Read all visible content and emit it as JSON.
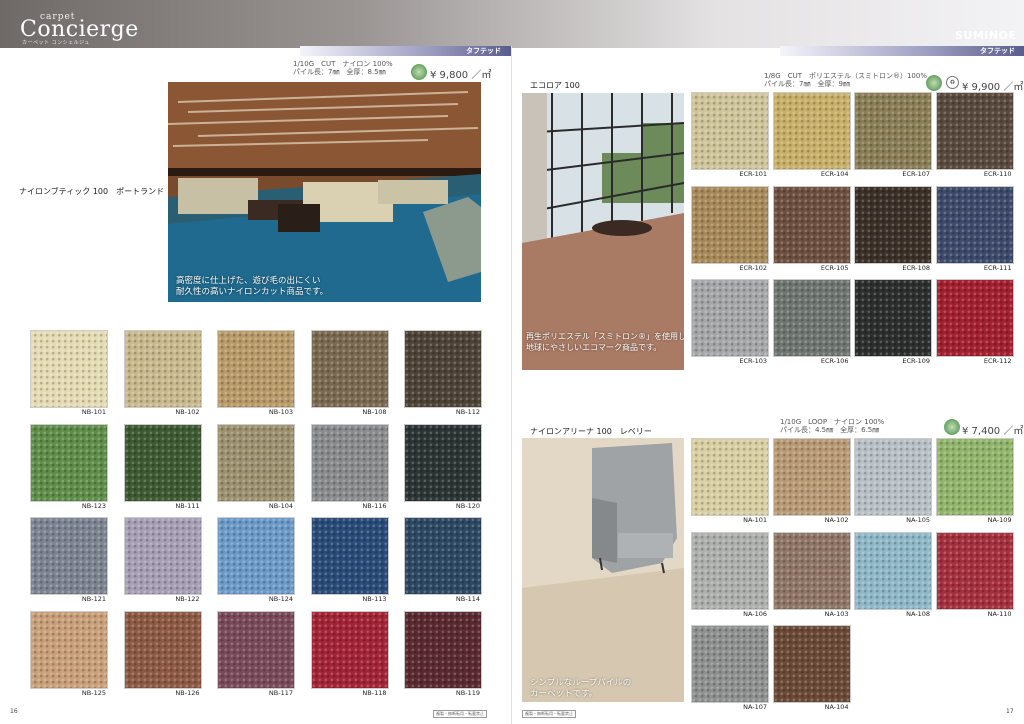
{
  "brand": {
    "small": "carpet",
    "big": "Concierge",
    "tag": "カーペット コンシェルジュ",
    "maker": "SUMINOE"
  },
  "tufted_label": "タフテッド",
  "pages": {
    "left": "16",
    "right": "17"
  },
  "stamp": "複製・無断転用・転載禁止",
  "sections": [
    {
      "name": "ナイロンブティック 100　ポートランド",
      "spec_line1": "1/10G　CUT　ナイロン 100%",
      "spec_line2": "パイル長：7㎜　全厚：8.5㎜",
      "price": "¥ 9,800 ／㎡",
      "caption": "高密度に仕上げた、遊び毛の出にくい\n耐久性の高いナイロンカット商品です。",
      "swatches": [
        {
          "code": "NB-101",
          "color": "#e5dcb5"
        },
        {
          "code": "NB-102",
          "color": "#c9b98d"
        },
        {
          "code": "NB-103",
          "color": "#b99b6a"
        },
        {
          "code": "NB-108",
          "color": "#7b6a52"
        },
        {
          "code": "NB-112",
          "color": "#4e4336"
        },
        {
          "code": "NB-123",
          "color": "#5f8d4a"
        },
        {
          "code": "NB-111",
          "color": "#3d5a32"
        },
        {
          "code": "NB-104",
          "color": "#9c9270"
        },
        {
          "code": "NB-116",
          "color": "#8a8b8c"
        },
        {
          "code": "NB-120",
          "color": "#2c3534"
        },
        {
          "code": "NB-121",
          "color": "#7d8491"
        },
        {
          "code": "NB-122",
          "color": "#a69fb5"
        },
        {
          "code": "NB-124",
          "color": "#6d9ac9"
        },
        {
          "code": "NB-113",
          "color": "#2a4a78"
        },
        {
          "code": "NB-114",
          "color": "#2c4862"
        },
        {
          "code": "NB-125",
          "color": "#c9a07a"
        },
        {
          "code": "NB-126",
          "color": "#8c5a44"
        },
        {
          "code": "NB-117",
          "color": "#7a4a5a"
        },
        {
          "code": "NB-118",
          "color": "#a32436"
        },
        {
          "code": "NB-119",
          "color": "#5a2a30"
        }
      ]
    },
    {
      "name": "エコロア 100",
      "spec_line1": "1/8G　CUT　ポリエステル（スミトロン®）100%",
      "spec_line2": "パイル長：7㎜　全厚：9㎜",
      "price": "¥ 9,900 ／㎡",
      "caption": "再生ポリエステル「スミトロン®」を使用した、\n地球にやさしいエコマーク商品です。",
      "swatches": [
        {
          "code": "ECR-101",
          "color": "#cfc49a"
        },
        {
          "code": "ECR-104",
          "color": "#c9b06a"
        },
        {
          "code": "ECR-107",
          "color": "#8a7e56"
        },
        {
          "code": "ECR-110",
          "color": "#5a4a3e"
        },
        {
          "code": "ECR-102",
          "color": "#a88a5a"
        },
        {
          "code": "ECR-105",
          "color": "#6e5040"
        },
        {
          "code": "ECR-108",
          "color": "#3c3028"
        },
        {
          "code": "ECR-111",
          "color": "#3e4a6c"
        },
        {
          "code": "ECR-103",
          "color": "#a5a7a8"
        },
        {
          "code": "ECR-106",
          "color": "#6f7672"
        },
        {
          "code": "ECR-109",
          "color": "#2c2e2d"
        },
        {
          "code": "ECR-112",
          "color": "#a2202f"
        }
      ]
    },
    {
      "name": "ナイロンアリーナ 100　レベリー",
      "spec_line1": "1/10G　LOOP　ナイロン 100%",
      "spec_line2": "パイル長：4.5㎜　全厚：6.5㎜",
      "price": "¥ 7,400 ／㎡",
      "caption": "シンプルなループパイルの\nカーペットです。",
      "swatches": [
        {
          "code": "NA-101",
          "color": "#d9cfa3"
        },
        {
          "code": "NA-102",
          "color": "#b89a75"
        },
        {
          "code": "NA-105",
          "color": "#b8c1c6"
        },
        {
          "code": "NA-109",
          "color": "#92b56c"
        },
        {
          "code": "NA-106",
          "color": "#aeb0ad"
        },
        {
          "code": "NA-103",
          "color": "#8f7666"
        },
        {
          "code": "NA-108",
          "color": "#8fb8c9"
        },
        {
          "code": "NA-110",
          "color": "#a5303e"
        },
        {
          "code": "NA-107",
          "color": "#8e918f"
        },
        {
          "code": "NA-104",
          "color": "#6a4a36"
        }
      ]
    }
  ],
  "colors": {
    "tag_bar": "#6a6c9c",
    "top_bar": "#7c7775"
  }
}
